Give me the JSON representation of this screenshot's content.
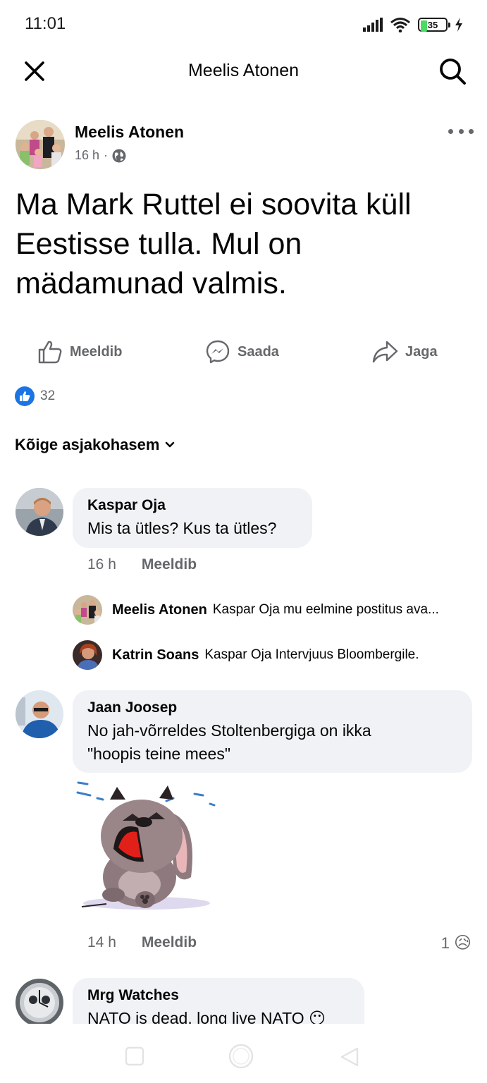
{
  "status": {
    "time": "11:01",
    "battery": "35",
    "battery_level": 0.35
  },
  "header": {
    "title": "Meelis Atonen"
  },
  "post": {
    "author": "Meelis Atonen",
    "time": "16 h",
    "dot": "·",
    "text": "Ma Mark Ruttel ei soovita küll Eestisse tulla. Mul on mädamunad valmis."
  },
  "actions": {
    "like": "Meeldib",
    "send": "Saada",
    "share": "Jaga"
  },
  "reactions": {
    "count": "32"
  },
  "sort": {
    "label": "Kõige asjakohasem"
  },
  "comments": [
    {
      "author": "Kaspar Oja",
      "text": "Mis ta ütles? Kus ta ütles?",
      "time": "16 h",
      "like": "Meeldib",
      "replies": [
        {
          "author": "Meelis Atonen",
          "text": "Kaspar Oja mu eelmine postitus  ava..."
        },
        {
          "author": "Katrin Soans",
          "text": "Kaspar Oja Intervjuus Bloombergile."
        }
      ]
    },
    {
      "author": "Jaan Joosep",
      "text_lines": [
        "No jah-võrreldes Stoltenbergiga on ikka",
        "\"hoopis teine mees\""
      ],
      "time": "14 h",
      "like": "Meeldib",
      "reaction_count": "1",
      "reaction_emoji": "😥"
    },
    {
      "author": "Mrg Watches",
      "text": "NATO is dead, long live NATO 😶"
    }
  ],
  "colors": {
    "accent": "#1b74e4",
    "secondary_text": "#65676b",
    "bubble": "#f0f2f5"
  }
}
